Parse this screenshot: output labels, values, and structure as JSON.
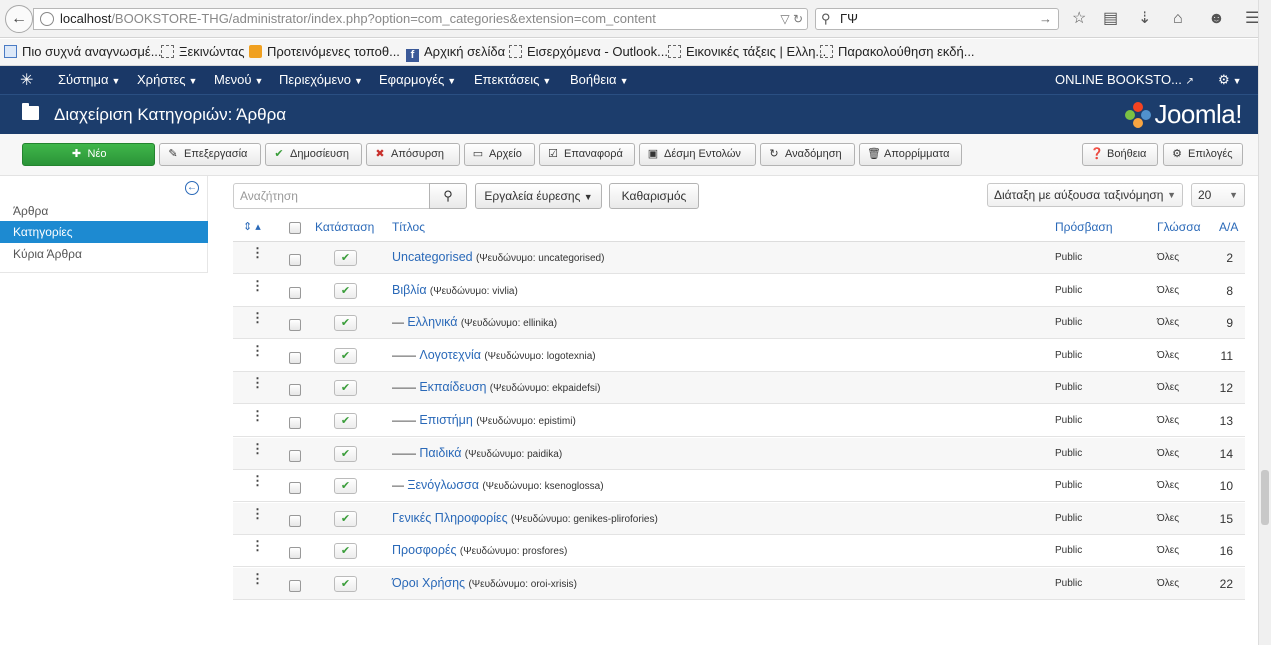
{
  "browser": {
    "url_host": "localhost",
    "url_rest": "/BOOKSTORE-THG/administrator/index.php?option=com_categories&extension=com_content",
    "search_value": "ΓΨ",
    "bookmarks": [
      "Πιο συχνά αναγνωσμέ...",
      "Ξεκινώντας",
      "Προτεινόμενες τοποθ...",
      "Αρχική σελίδα",
      "Εισερχόμενα - Outlook...",
      "Εικονικές τάξεις | Ελλη...",
      "Παρακολούθηση εκδή..."
    ]
  },
  "nav": {
    "items": [
      "Σύστημα",
      "Χρήστες",
      "Μενού",
      "Περιεχόμενο",
      "Εφαρμογές",
      "Επεκτάσεις",
      "Βοήθεια"
    ],
    "site_name": "ONLINE BOOKSTO..."
  },
  "header": {
    "title": "Διαχείριση Κατηγοριών: Άρθρα",
    "logo": "Joomla!"
  },
  "toolbar": {
    "new": "Νέο",
    "edit": "Επεξεργασία",
    "publish": "Δημοσίευση",
    "unpublish": "Απόσυρση",
    "archive": "Αρχείο",
    "checkin": "Επαναφορά",
    "batch": "Δέσμη Εντολών",
    "rebuild": "Αναδόμηση",
    "trash": "Απορρίμματα",
    "help": "Βοήθεια",
    "options": "Επιλογές"
  },
  "sidebar": {
    "items": [
      {
        "label": "Άρθρα"
      },
      {
        "label": "Κατηγορίες"
      },
      {
        "label": "Κύρια Άρθρα"
      }
    ]
  },
  "filters": {
    "search_placeholder": "Αναζήτηση",
    "search_tools": "Εργαλεία έυρεσης",
    "clear": "Καθαρισμός",
    "ordering": "Διάταξη με αύξουσα ταξινόμηση",
    "limit": "20"
  },
  "table": {
    "headers": {
      "status": "Κατάσταση",
      "title": "Τίτλος",
      "access": "Πρόσβαση",
      "language": "Γλώσσα",
      "id": "Α/Α"
    },
    "alias_prefix": "(Ψευδώνυμο: ",
    "rows": [
      {
        "dash": "",
        "title": "Uncategorised",
        "alias": "uncategorised",
        "access": "Public",
        "language": "Όλες",
        "id": "2"
      },
      {
        "dash": "",
        "title": "Βιβλία",
        "alias": "vivlia",
        "access": "Public",
        "language": "Όλες",
        "id": "8"
      },
      {
        "dash": "—",
        "title": "Ελληνικά",
        "alias": "ellinika",
        "access": "Public",
        "language": "Όλες",
        "id": "9"
      },
      {
        "dash": "——",
        "title": "Λογοτεχνία",
        "alias": "logotexnia",
        "access": "Public",
        "language": "Όλες",
        "id": "11"
      },
      {
        "dash": "——",
        "title": "Εκπαίδευση",
        "alias": "ekpaidefsi",
        "access": "Public",
        "language": "Όλες",
        "id": "12"
      },
      {
        "dash": "——",
        "title": "Επιστήμη",
        "alias": "epistimi",
        "access": "Public",
        "language": "Όλες",
        "id": "13"
      },
      {
        "dash": "——",
        "title": "Παιδικά",
        "alias": "paidika",
        "access": "Public",
        "language": "Όλες",
        "id": "14"
      },
      {
        "dash": "—",
        "title": "Ξενόγλωσσα",
        "alias": "ksenoglossa",
        "access": "Public",
        "language": "Όλες",
        "id": "10"
      },
      {
        "dash": "",
        "title": "Γενικές Πληροφορίες",
        "alias": "genikes-plirofories",
        "access": "Public",
        "language": "Όλες",
        "id": "15"
      },
      {
        "dash": "",
        "title": "Προσφορές",
        "alias": "prosfores",
        "access": "Public",
        "language": "Όλες",
        "id": "16"
      },
      {
        "dash": "",
        "title": "Όροι Χρήσης",
        "alias": "oroi-xrisis",
        "access": "Public",
        "language": "Όλες",
        "id": "22"
      }
    ]
  }
}
